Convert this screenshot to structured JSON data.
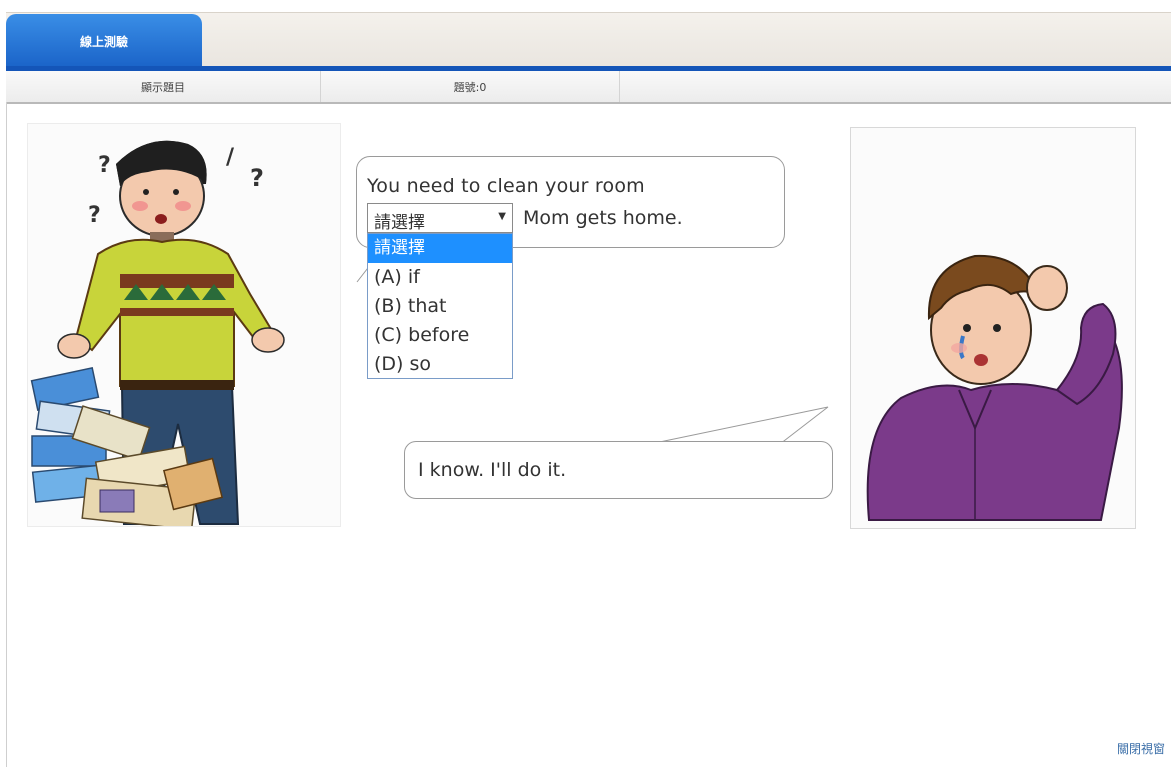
{
  "tabs": {
    "active_label": "線上測驗"
  },
  "infobar": {
    "show_question_label": "顯示題目",
    "question_number_label": "題號:0"
  },
  "dialogue": {
    "line1_before": "You need to clean your room",
    "line1_after": "Mom gets home.",
    "line2": "I know. I'll do it."
  },
  "answer_select": {
    "selected_value": "請選擇",
    "options": [
      "請選擇",
      "(A) if",
      "(B) that",
      "(C) before",
      "(D) so"
    ]
  },
  "footer": {
    "link_label": "關閉視窗"
  },
  "colors": {
    "tab_blue": "#1a63c8",
    "rule_blue": "#1455b8",
    "option_highlight": "#1e90ff",
    "footer_link": "#3a6ea8"
  }
}
